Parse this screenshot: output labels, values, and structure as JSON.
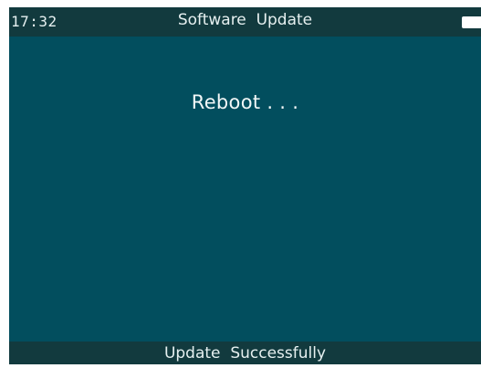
{
  "status_bar": {
    "time": "17:32",
    "title": "Software  Update",
    "battery_icon": "battery-icon"
  },
  "main": {
    "message": "Reboot . . ."
  },
  "bottom_bar": {
    "status_text": "Update  Successfully"
  },
  "colors": {
    "screen_background": "#024e5e",
    "bar_background": "#123a3e",
    "text": "#e6f0f0"
  }
}
